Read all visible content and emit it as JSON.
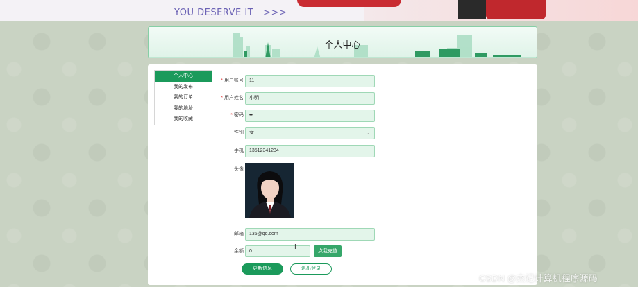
{
  "header": {
    "slogan": "YOU DESERVE IT",
    "slogan_arrows": ">>>"
  },
  "page_title": "个人中心",
  "sidebar": {
    "items": [
      {
        "label": "个人中心",
        "active": true
      },
      {
        "label": "我的发布",
        "active": false
      },
      {
        "label": "我的订单",
        "active": false
      },
      {
        "label": "我的地址",
        "active": false
      },
      {
        "label": "我的收藏",
        "active": false
      }
    ]
  },
  "form": {
    "account": {
      "label": "用户账号",
      "value": "11",
      "required": true
    },
    "name": {
      "label": "用户姓名",
      "value": "小明",
      "required": true
    },
    "password": {
      "label": "密码",
      "value": "••",
      "required": true
    },
    "gender": {
      "label": "性别",
      "value": "女"
    },
    "phone": {
      "label": "手机",
      "value": "13512341234"
    },
    "avatar": {
      "label": "头像"
    },
    "email": {
      "label": "邮箱",
      "value": "135@qq.com"
    },
    "balance": {
      "label": "余额",
      "value": "0"
    },
    "recharge_label": "点我充值"
  },
  "buttons": {
    "update": "更新信息",
    "logout": "退出登录"
  },
  "watermark": "CSDN @杰记计算机程序源码",
  "colors": {
    "primary": "#1b9a5b",
    "field_bg": "#e3f5ea",
    "field_border": "#9fd8b6"
  }
}
